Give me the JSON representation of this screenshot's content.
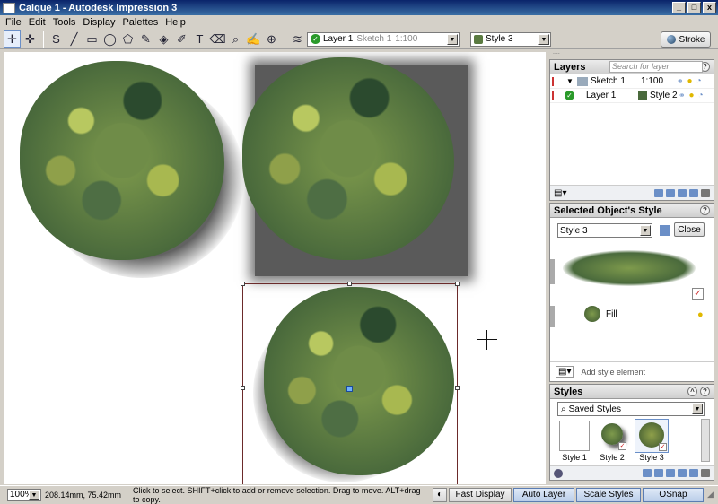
{
  "window": {
    "title": "Calque 1 - Autodesk Impression 3",
    "min": "_",
    "max": "□",
    "close": "x"
  },
  "menu": [
    "File",
    "Edit",
    "Tools",
    "Display",
    "Palettes",
    "Help"
  ],
  "toolbar": {
    "layer_value": "Layer 1",
    "sketch_label": "Sketch 1",
    "scale": "1:100",
    "style_value": "Style 3",
    "stroke_label": "Stroke",
    "text_tool_glyph": "T"
  },
  "layers_panel": {
    "title": "Layers",
    "search_placeholder": "Search for layer",
    "rows": [
      {
        "name": "Sketch 1",
        "scale": "1:100"
      },
      {
        "name": "Layer 1",
        "style": "Style 2"
      }
    ]
  },
  "object_style_panel": {
    "title": "Selected Object's Style",
    "style_value": "Style 3",
    "close_label": "Close",
    "fill_label": "Fill",
    "add_element_label": "Add style element"
  },
  "styles_panel": {
    "title": "Styles",
    "filter_value": "Saved Styles",
    "items": [
      "Style 1",
      "Style 2",
      "Style 3"
    ]
  },
  "status": {
    "zoom": "100%",
    "coords": "208.14mm, 75.42mm",
    "hint": "Click to select. SHIFT+click to add or remove selection. Drag to move. ALT+drag to copy.",
    "buttons": [
      "Fast Display",
      "Auto Layer",
      "Scale Styles",
      "OSnap"
    ]
  },
  "colors": {
    "titlebar": "#0a246a",
    "accent": "#6a8fc8",
    "selection": "#6b2a2a"
  }
}
